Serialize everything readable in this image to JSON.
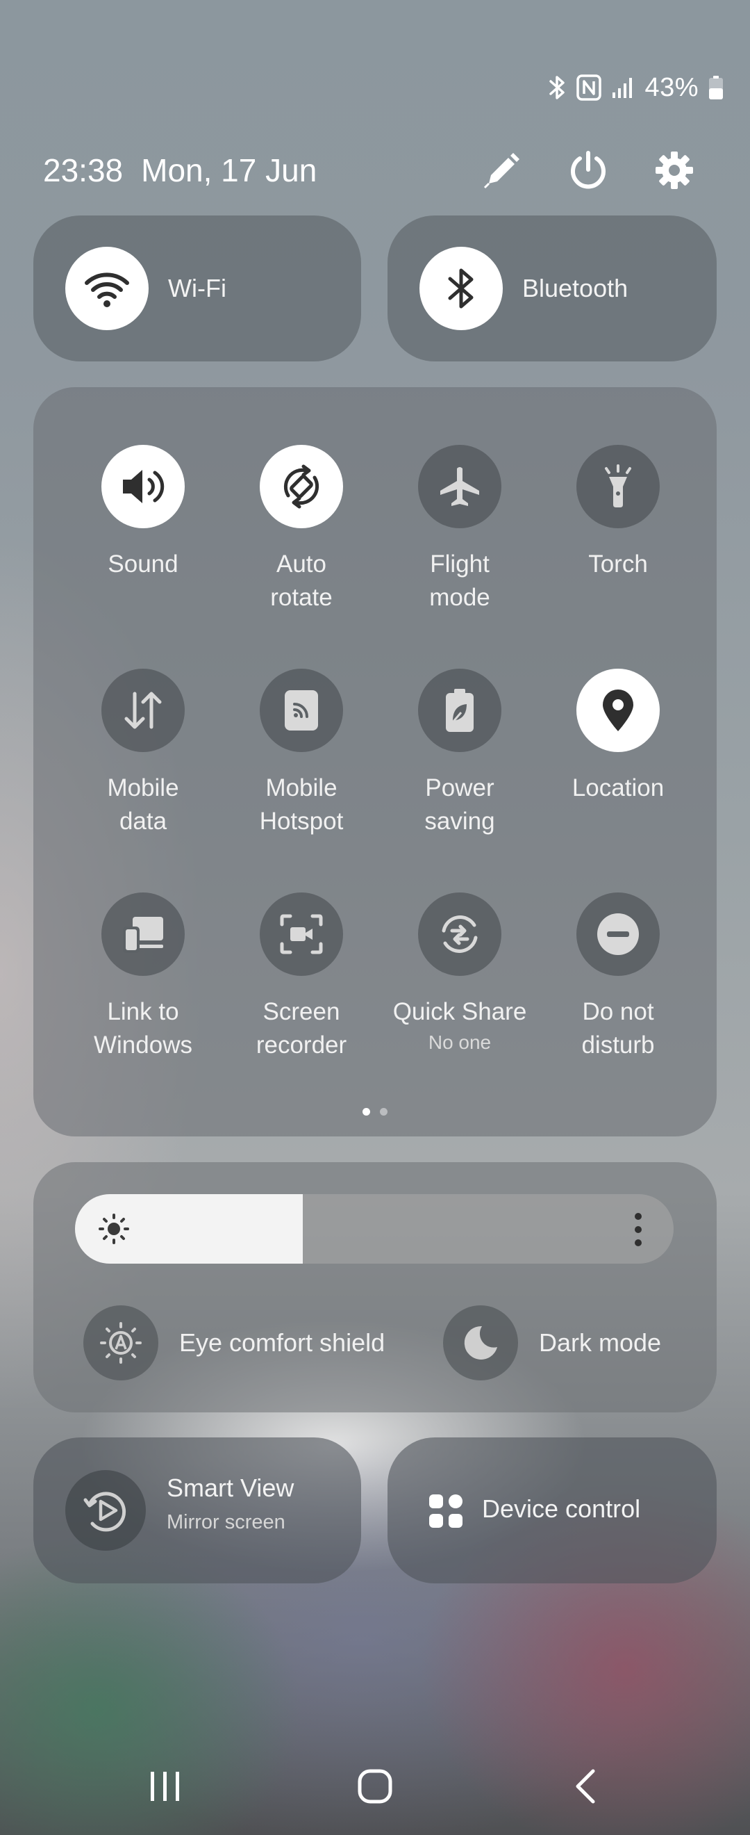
{
  "status_bar": {
    "battery_percent": "43%",
    "icons": [
      "bluetooth-icon",
      "nfc-icon",
      "signal-icon",
      "battery-icon"
    ]
  },
  "header": {
    "time": "23:38",
    "date": "Mon, 17 Jun",
    "actions": [
      "edit-icon",
      "power-icon",
      "settings-icon"
    ]
  },
  "top_toggles": [
    {
      "label": "Wi-Fi",
      "icon": "wifi-icon",
      "active": true
    },
    {
      "label": "Bluetooth",
      "icon": "bluetooth-icon",
      "active": true
    }
  ],
  "quick_tiles": [
    {
      "label": "Sound",
      "icon": "sound-icon",
      "active": true
    },
    {
      "label": "Auto\nrotate",
      "icon": "auto-rotate-icon",
      "active": true
    },
    {
      "label": "Flight\nmode",
      "icon": "airplane-icon",
      "active": false
    },
    {
      "label": "Torch",
      "icon": "torch-icon",
      "active": false
    },
    {
      "label": "Mobile\ndata",
      "icon": "mobile-data-icon",
      "active": false
    },
    {
      "label": "Mobile\nHotspot",
      "icon": "hotspot-icon",
      "active": false
    },
    {
      "label": "Power\nsaving",
      "icon": "power-saving-icon",
      "active": false
    },
    {
      "label": "Location",
      "icon": "location-icon",
      "active": true
    },
    {
      "label": "Link to\nWindows",
      "icon": "link-to-windows-icon",
      "active": false
    },
    {
      "label": "Screen\nrecorder",
      "icon": "screen-recorder-icon",
      "active": false
    },
    {
      "label": "Quick Share",
      "sublabel": "No one",
      "icon": "quick-share-icon",
      "active": false
    },
    {
      "label": "Do not\ndisturb",
      "icon": "do-not-disturb-icon",
      "active": false
    }
  ],
  "pager": {
    "pages": 2,
    "current": 1
  },
  "brightness": {
    "level": 0.38,
    "icon": "brightness-icon",
    "more_icon": "more-vertical-icon"
  },
  "display_options": [
    {
      "label": "Eye comfort shield",
      "icon": "eye-comfort-icon"
    },
    {
      "label": "Dark mode",
      "icon": "dark-mode-icon"
    }
  ],
  "smart_view": {
    "title": "Smart View",
    "subtitle": "Mirror screen",
    "icon": "smart-view-icon"
  },
  "device_control": {
    "label": "Device control",
    "icon": "device-control-icon"
  },
  "nav_bar": [
    "recents-icon",
    "home-icon",
    "back-icon"
  ],
  "colors": {
    "active_tile": "#ffffff",
    "icon_dark": "#333333",
    "icon_light": "#ffffff"
  }
}
